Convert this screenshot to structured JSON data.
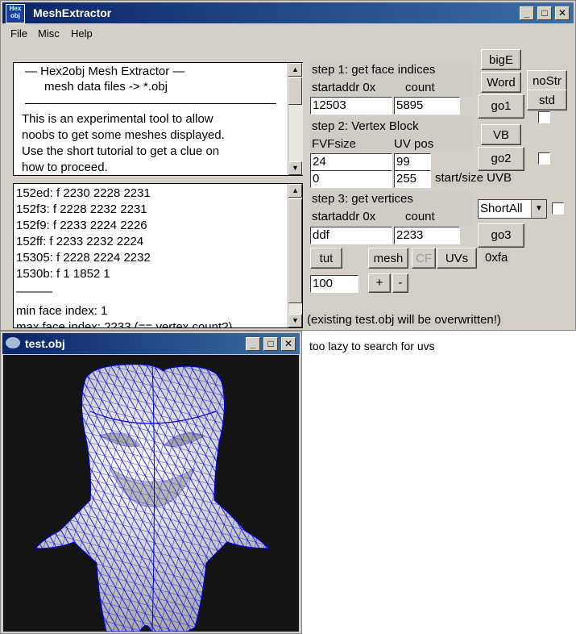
{
  "main_window": {
    "title": "MeshExtractor",
    "icon_text": "Hex\nobj",
    "menu": [
      "File",
      "Misc",
      "Help"
    ],
    "info_box": {
      "line1": "—   Hex2obj Mesh Extractor   —",
      "line2": "mesh data files -> *.obj",
      "para": [
        "This is an experimental tool to allow",
        "noobs to get some meshes displayed.",
        "Use the short tutorial to get a clue on",
        "how to proceed."
      ]
    },
    "output_lines": [
      "152ed: f  2230 2228 2231",
      "152f3: f  2228 2232 2231",
      "152f9: f  2233 2224 2226",
      "152ff: f  2233 2232 2224",
      "15305: f  2228 2224 2232",
      "1530b: f  1 1852 1",
      "———",
      "min face index: 1",
      "max face index: 2233 (== vertex count?)"
    ],
    "step1": {
      "title": "step 1: get face indices",
      "startaddr_label": "startaddr 0x",
      "count_label": "count",
      "startaddr": "12503",
      "count": "5895"
    },
    "step2": {
      "title": "step 2: Vertex Block",
      "fvf_label": "FVFsize",
      "uvpos_label": "UV pos",
      "fvf": "24",
      "uvpos": "99",
      "start": "0",
      "size": "255",
      "startsize_label": "start/size UVB"
    },
    "step3": {
      "title": "step 3: get vertices",
      "startaddr_label": "startaddr 0x",
      "count_label": "count",
      "startaddr": "ddf",
      "count": "2233"
    },
    "buttons": {
      "bigE": "bigE",
      "word": "Word",
      "noStr": "noStr",
      "std": "std",
      "go1": "go1",
      "vb": "VB",
      "go2": "go2",
      "go3": "go3",
      "tut": "tut",
      "mesh": "mesh",
      "cf": "CF",
      "uvs": "UVs",
      "plus": "+",
      "minus": "-"
    },
    "select_value": "ShortAll",
    "hex_label": "0xfa",
    "zoom_value": "100",
    "overwrite_note": "(existing test.obj will be overwritten!)"
  },
  "obj_window": {
    "title": "test.obj"
  },
  "side_note": "too lazy to search for uvs",
  "colors": {
    "mesh_fill": "#ffffff",
    "wire": "#0000ee",
    "viewport_bg": "#141414",
    "title_bar": "#0a246a"
  }
}
